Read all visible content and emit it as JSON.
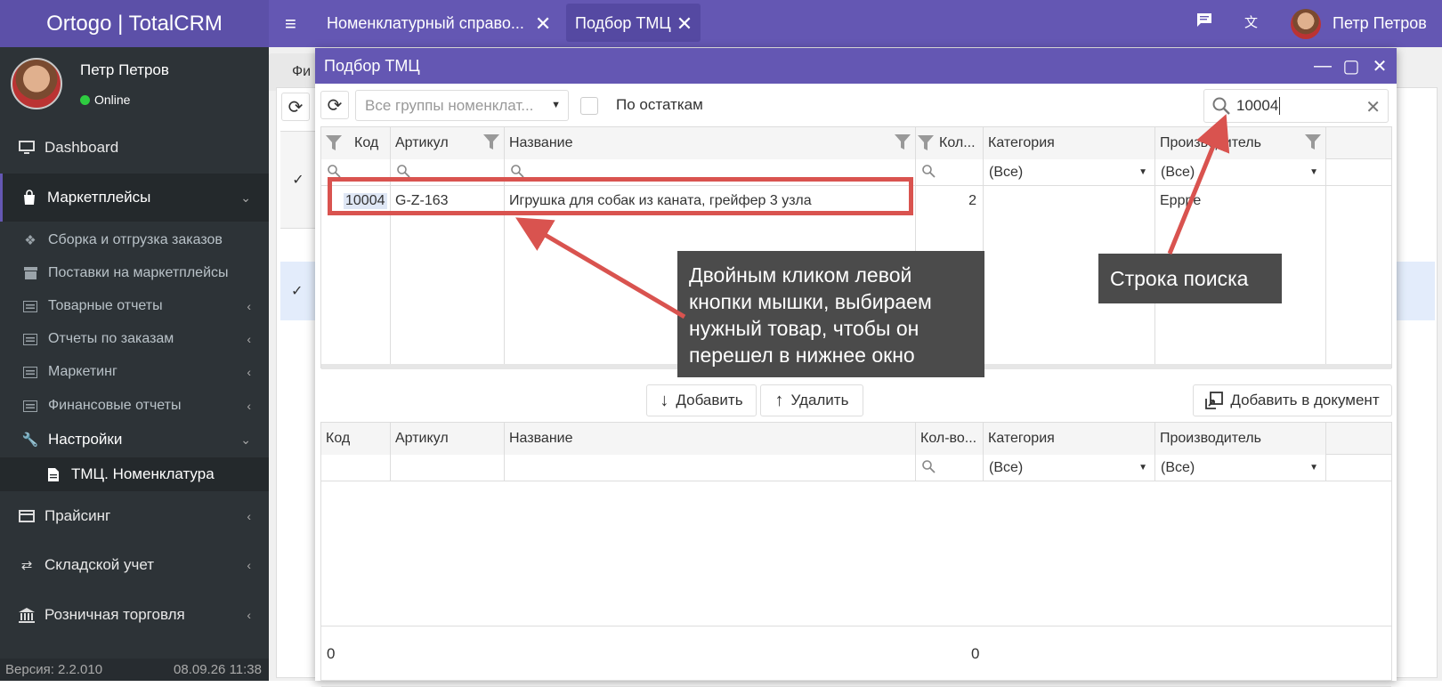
{
  "app": {
    "brand": "Ortogo | TotalCRM"
  },
  "user": {
    "name": "Петр Петров",
    "status": "Online"
  },
  "sidebar": {
    "items": [
      {
        "label": "Dashboard",
        "icon": "monitor-icon"
      },
      {
        "label": "Маркетплейсы",
        "icon": "shopping-bag-icon"
      },
      {
        "label": "Сборка и отгрузка заказов",
        "icon": "dropbox-icon"
      },
      {
        "label": "Поставки на маркетплейсы",
        "icon": "archive-icon"
      },
      {
        "label": "Товарные отчеты",
        "icon": "list-icon"
      },
      {
        "label": "Отчеты по заказам",
        "icon": "list-icon"
      },
      {
        "label": "Маркетинг",
        "icon": "list-icon"
      },
      {
        "label": "Финансовые отчеты",
        "icon": "list-icon"
      },
      {
        "label": "Настройки",
        "icon": "wrench-icon"
      },
      {
        "label": "ТМЦ. Номенклатура",
        "icon": "file-icon"
      },
      {
        "label": "Прайсинг",
        "icon": "credit-card-icon"
      },
      {
        "label": "Складской учет",
        "icon": "exchange-icon"
      },
      {
        "label": "Розничная торговля",
        "icon": "bank-icon"
      }
    ],
    "version": "Версия: 2.2.010",
    "datetime": "08.09.26 11:38"
  },
  "topbar": {
    "tabs": [
      {
        "label": "Номенклатурный справо..."
      },
      {
        "label": "Подбор ТМЦ"
      }
    ],
    "user_name": "Петр Петров"
  },
  "background": {
    "tab_partial": "Фи"
  },
  "dialog": {
    "title": "Подбор ТМЦ",
    "group_placeholder": "Все группы номенклат...",
    "stock_label": "По остаткам",
    "search_value": "10004",
    "top_grid": {
      "columns": [
        "Код",
        "Артикул",
        "Название",
        "Кол...",
        "Категория",
        "Производитель"
      ],
      "filters": {
        "category": "(Все)",
        "producer": "(Все)"
      },
      "rows": [
        {
          "code": "10004",
          "article": "G-Z-163",
          "name": "Игрушка для собак из каната, грейфер 3 узла",
          "qty": "2",
          "category": "",
          "producer": "Еppрe"
        }
      ]
    },
    "actions": {
      "add": "Добавить",
      "remove": "Удалить",
      "add_to_doc": "Добавить в документ"
    },
    "bottom_grid": {
      "columns": [
        "Код",
        "Артикул",
        "Название",
        "Кол-во...",
        "Категория",
        "Производитель"
      ],
      "filters": {
        "category": "(Все)",
        "producer": "(Все)"
      },
      "footer": {
        "count": "0",
        "qty": "0"
      }
    }
  },
  "annotations": {
    "callout_main": [
      "Двойным кликом левой",
      "кнопки мышки, выбираем",
      "нужный товар, чтобы он",
      "перешел в нижнее окно"
    ],
    "callout_search": "Строка поиска",
    "color": "#d9534f"
  }
}
